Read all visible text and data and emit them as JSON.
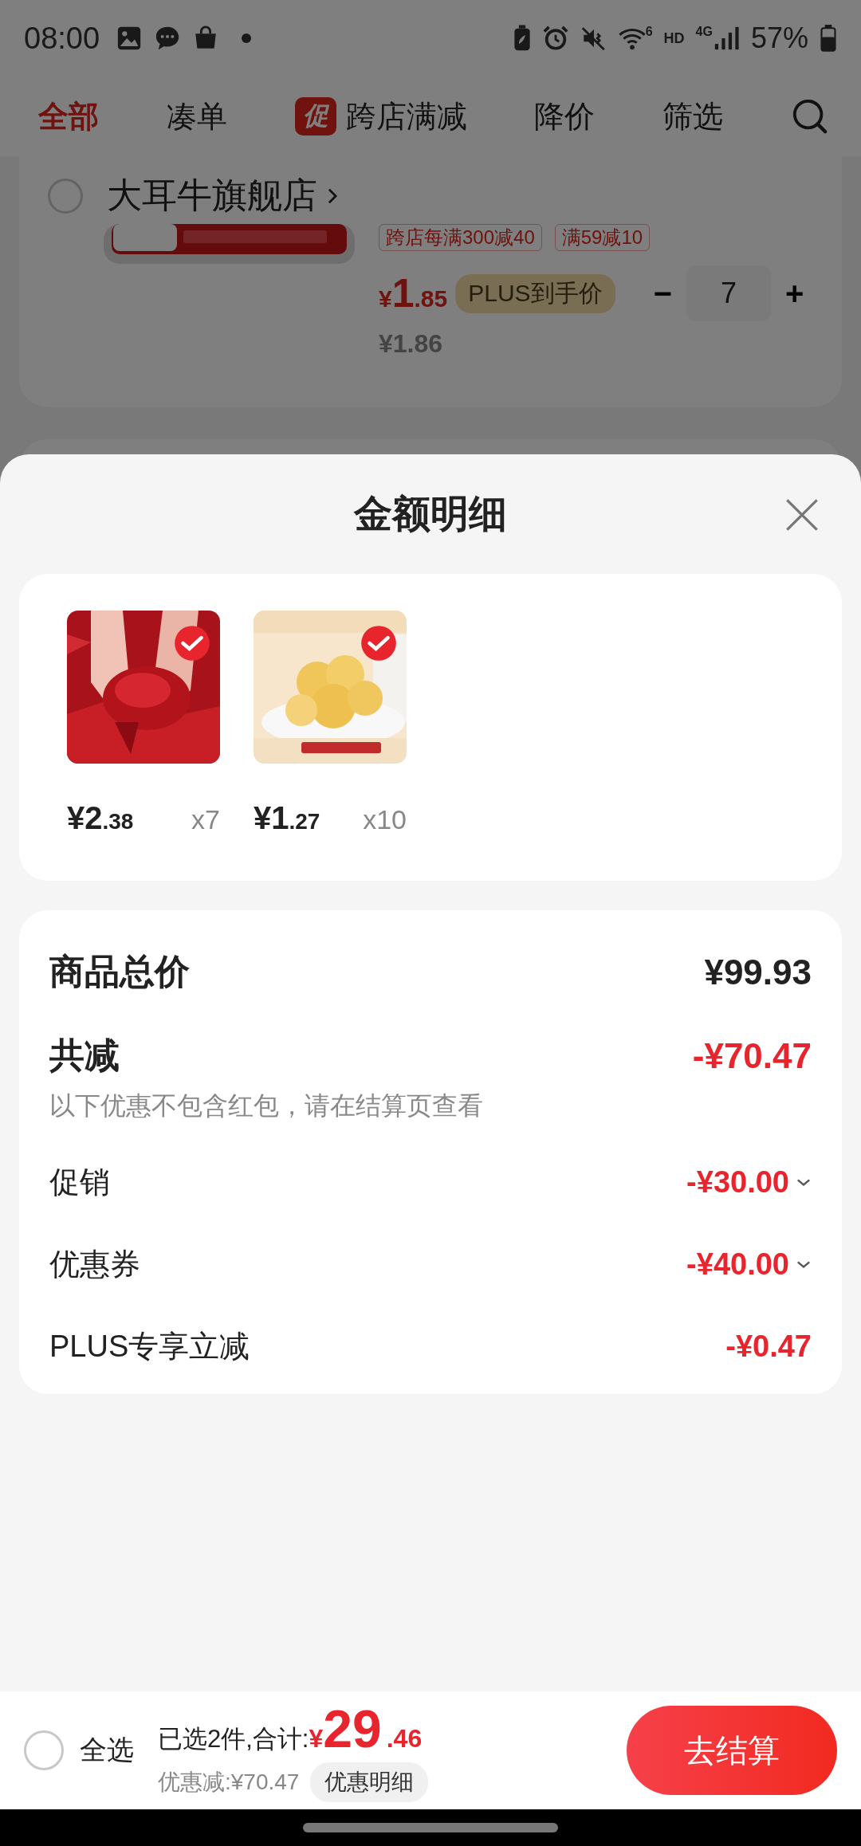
{
  "status_bar": {
    "time": "08:00",
    "wifi_label": "6",
    "hd": "HD",
    "network": "4G",
    "battery": "57%"
  },
  "tabs": [
    {
      "label": "全部",
      "selected": true
    },
    {
      "label": "凑单",
      "selected": false
    },
    {
      "label": "跨店满减",
      "badge": "促",
      "selected": false
    },
    {
      "label": "降价",
      "selected": false
    },
    {
      "label": "筛选",
      "selected": false
    }
  ],
  "store_card": {
    "store_name": "大耳牛旗舰店",
    "checked": false,
    "tags": [
      "跨店每满300减40",
      "满59减10"
    ],
    "currency": "¥",
    "price_int": "1",
    "price_dec": ".85",
    "plus_label": "PLUS到手价",
    "minus": "−",
    "quantity": "7",
    "plus": "+",
    "original_price": "¥1.86"
  },
  "sheet": {
    "title": "金额明细"
  },
  "items": [
    {
      "kind": "picture",
      "selected": true,
      "price_int": "¥2",
      "price_dec": ".38",
      "quantity": "x7"
    },
    {
      "kind": "picture",
      "selected": true,
      "price_int": "¥1",
      "price_dec": ".27",
      "quantity": "x10"
    }
  ],
  "summary": {
    "total_label": "商品总价",
    "total_value": "¥99.93",
    "discount_label": "共减",
    "discount_value": "-¥70.47",
    "note": "以下优惠不包含红包，请在结算页查看",
    "rows": [
      {
        "label": "促销",
        "value": "-¥30.00",
        "expandable": true
      },
      {
        "label": "优惠券",
        "value": "-¥40.00",
        "expandable": true
      },
      {
        "label": "PLUS专享立减",
        "value": "-¥0.47",
        "expandable": false
      }
    ]
  },
  "bottom_bar": {
    "select_all": "全选",
    "checked": false,
    "selected_text": "已选2件,合计:",
    "currency": "¥",
    "total_int": "29",
    "total_dec": ".46",
    "saving": "优惠减:¥70.47",
    "detail_button": "优惠明细",
    "checkout": "去结算"
  }
}
